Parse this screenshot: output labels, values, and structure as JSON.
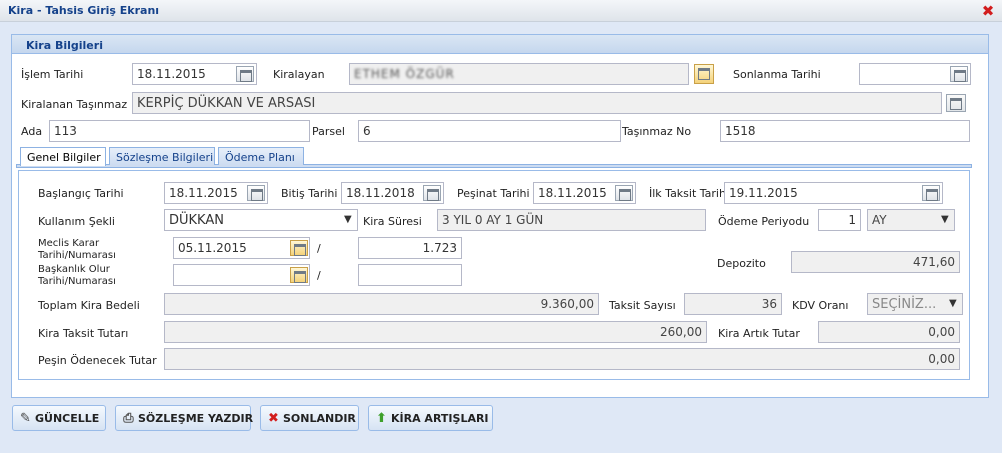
{
  "window": {
    "title": "Kira - Tahsis Giriş Ekranı"
  },
  "panel": {
    "title": "Kira Bilgileri"
  },
  "header_fields": {
    "islem_tarihi_label": "İşlem Tarihi",
    "islem_tarihi_value": "18.11.2015",
    "kiralayan_label": "Kiralayan",
    "kiralayan_value": "ETHEM ÖZGÜR",
    "sonlanma_tarihi_label": "Sonlanma Tarihi",
    "sonlanma_tarihi_value": "",
    "kiralanan_tasinmaz_label": "Kiralanan Taşınmaz",
    "kiralanan_tasinmaz_value": "KERPİÇ DÜKKAN VE ARSASI",
    "ada_label": "Ada",
    "ada_value": "113",
    "parsel_label": "Parsel",
    "parsel_value": "6",
    "tasinmaz_no_label": "Taşınmaz No",
    "tasinmaz_no_value": "1518"
  },
  "tabs": [
    {
      "label": "Genel Bilgiler",
      "active": true
    },
    {
      "label": "Sözleşme Bilgileri",
      "active": false
    },
    {
      "label": "Ödeme Planı",
      "active": false
    }
  ],
  "genel": {
    "baslangic_tarihi_label": "Başlangıç Tarihi",
    "baslangic_tarihi_value": "18.11.2015",
    "bitis_tarihi_label": "Bitiş Tarihi",
    "bitis_tarihi_value": "18.11.2018",
    "pesinat_tarihi_label": "Peşinat Tarihi",
    "pesinat_tarihi_value": "18.11.2015",
    "ilk_taksit_tarihi_label": "İlk Taksit Tarihi",
    "ilk_taksit_tarihi_value": "19.11.2015",
    "kullanim_sekli_label": "Kullanım Şekli",
    "kullanim_sekli_value": "DÜKKAN",
    "kira_suresi_label": "Kira Süresi",
    "kira_suresi_value": "3 YIL 0 AY 1 GÜN",
    "odeme_periyodu_label": "Ödeme Periyodu",
    "odeme_periyodu_value": "1",
    "odeme_periyodu_unit": "AY",
    "meclis_karar_label_1": "Meclis Karar",
    "meclis_karar_label_2": "Tarihi/Numarası",
    "meclis_karar_tarihi": "05.11.2015",
    "meclis_karar_numarasi": "1.723",
    "baskanlik_olur_label_1": "Başkanlık Olur",
    "baskanlik_olur_label_2": "Tarihi/Numarası",
    "baskanlik_olur_tarihi": "",
    "baskanlik_olur_numarasi": "",
    "slash": "/",
    "depozito_label": "Depozito",
    "depozito_value": "471,60",
    "toplam_kira_bedeli_label": "Toplam Kira Bedeli",
    "toplam_kira_bedeli_value": "9.360,00",
    "taksit_sayisi_label": "Taksit Sayısı",
    "taksit_sayisi_value": "36",
    "kdv_orani_label": "KDV Oranı",
    "kdv_orani_value": "SEÇİNİZ...",
    "kira_taksit_tutari_label": "Kira Taksit Tutarı",
    "kira_taksit_tutari_value": "260,00",
    "kira_artik_tutar_label": "Kira Artık Tutar",
    "kira_artik_tutar_value": "0,00",
    "pesin_odenecek_tutar_label": "Peşin Ödenecek Tutar",
    "pesin_odenecek_tutar_value": "0,00"
  },
  "buttons": {
    "guncelle": "GÜNCELLE",
    "sozlesme_yazdir": "SÖZLEŞME YAZDIR",
    "sonlandir": "SONLANDIR",
    "kira_artislari": "KİRA ARTIŞLARI"
  },
  "icons": {
    "guncelle": "refresh-icon",
    "sozlesme_yazdir": "printer-icon",
    "sonlandir": "delete-icon",
    "kira_artislari": "arrow-up-icon",
    "kiralayan_picker": "hand-pointer-icon",
    "tasinmaz_search": "magnifier-icon",
    "close": "close-icon"
  },
  "colors": {
    "title_text": "#15428b",
    "close_red": "#d21d1d",
    "panel_border": "#99bbe8"
  }
}
